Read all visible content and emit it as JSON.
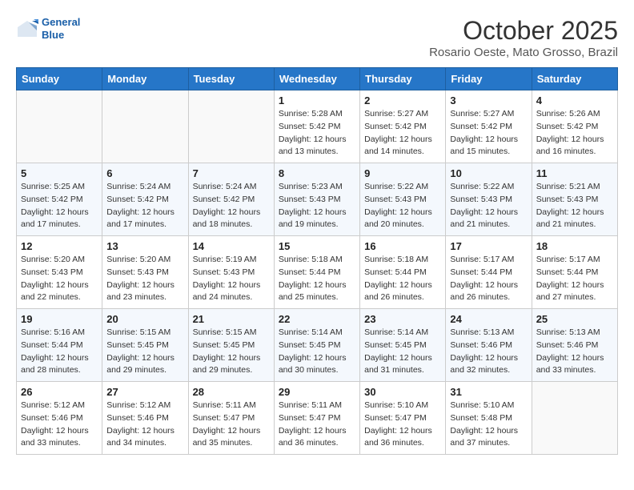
{
  "header": {
    "logo_line1": "General",
    "logo_line2": "Blue",
    "title": "October 2025",
    "subtitle": "Rosario Oeste, Mato Grosso, Brazil"
  },
  "days_of_week": [
    "Sunday",
    "Monday",
    "Tuesday",
    "Wednesday",
    "Thursday",
    "Friday",
    "Saturday"
  ],
  "weeks": [
    [
      {
        "day": "",
        "info": ""
      },
      {
        "day": "",
        "info": ""
      },
      {
        "day": "",
        "info": ""
      },
      {
        "day": "1",
        "info": "Sunrise: 5:28 AM\nSunset: 5:42 PM\nDaylight: 12 hours\nand 13 minutes."
      },
      {
        "day": "2",
        "info": "Sunrise: 5:27 AM\nSunset: 5:42 PM\nDaylight: 12 hours\nand 14 minutes."
      },
      {
        "day": "3",
        "info": "Sunrise: 5:27 AM\nSunset: 5:42 PM\nDaylight: 12 hours\nand 15 minutes."
      },
      {
        "day": "4",
        "info": "Sunrise: 5:26 AM\nSunset: 5:42 PM\nDaylight: 12 hours\nand 16 minutes."
      }
    ],
    [
      {
        "day": "5",
        "info": "Sunrise: 5:25 AM\nSunset: 5:42 PM\nDaylight: 12 hours\nand 17 minutes."
      },
      {
        "day": "6",
        "info": "Sunrise: 5:24 AM\nSunset: 5:42 PM\nDaylight: 12 hours\nand 17 minutes."
      },
      {
        "day": "7",
        "info": "Sunrise: 5:24 AM\nSunset: 5:42 PM\nDaylight: 12 hours\nand 18 minutes."
      },
      {
        "day": "8",
        "info": "Sunrise: 5:23 AM\nSunset: 5:43 PM\nDaylight: 12 hours\nand 19 minutes."
      },
      {
        "day": "9",
        "info": "Sunrise: 5:22 AM\nSunset: 5:43 PM\nDaylight: 12 hours\nand 20 minutes."
      },
      {
        "day": "10",
        "info": "Sunrise: 5:22 AM\nSunset: 5:43 PM\nDaylight: 12 hours\nand 21 minutes."
      },
      {
        "day": "11",
        "info": "Sunrise: 5:21 AM\nSunset: 5:43 PM\nDaylight: 12 hours\nand 21 minutes."
      }
    ],
    [
      {
        "day": "12",
        "info": "Sunrise: 5:20 AM\nSunset: 5:43 PM\nDaylight: 12 hours\nand 22 minutes."
      },
      {
        "day": "13",
        "info": "Sunrise: 5:20 AM\nSunset: 5:43 PM\nDaylight: 12 hours\nand 23 minutes."
      },
      {
        "day": "14",
        "info": "Sunrise: 5:19 AM\nSunset: 5:43 PM\nDaylight: 12 hours\nand 24 minutes."
      },
      {
        "day": "15",
        "info": "Sunrise: 5:18 AM\nSunset: 5:44 PM\nDaylight: 12 hours\nand 25 minutes."
      },
      {
        "day": "16",
        "info": "Sunrise: 5:18 AM\nSunset: 5:44 PM\nDaylight: 12 hours\nand 26 minutes."
      },
      {
        "day": "17",
        "info": "Sunrise: 5:17 AM\nSunset: 5:44 PM\nDaylight: 12 hours\nand 26 minutes."
      },
      {
        "day": "18",
        "info": "Sunrise: 5:17 AM\nSunset: 5:44 PM\nDaylight: 12 hours\nand 27 minutes."
      }
    ],
    [
      {
        "day": "19",
        "info": "Sunrise: 5:16 AM\nSunset: 5:44 PM\nDaylight: 12 hours\nand 28 minutes."
      },
      {
        "day": "20",
        "info": "Sunrise: 5:15 AM\nSunset: 5:45 PM\nDaylight: 12 hours\nand 29 minutes."
      },
      {
        "day": "21",
        "info": "Sunrise: 5:15 AM\nSunset: 5:45 PM\nDaylight: 12 hours\nand 29 minutes."
      },
      {
        "day": "22",
        "info": "Sunrise: 5:14 AM\nSunset: 5:45 PM\nDaylight: 12 hours\nand 30 minutes."
      },
      {
        "day": "23",
        "info": "Sunrise: 5:14 AM\nSunset: 5:45 PM\nDaylight: 12 hours\nand 31 minutes."
      },
      {
        "day": "24",
        "info": "Sunrise: 5:13 AM\nSunset: 5:46 PM\nDaylight: 12 hours\nand 32 minutes."
      },
      {
        "day": "25",
        "info": "Sunrise: 5:13 AM\nSunset: 5:46 PM\nDaylight: 12 hours\nand 33 minutes."
      }
    ],
    [
      {
        "day": "26",
        "info": "Sunrise: 5:12 AM\nSunset: 5:46 PM\nDaylight: 12 hours\nand 33 minutes."
      },
      {
        "day": "27",
        "info": "Sunrise: 5:12 AM\nSunset: 5:46 PM\nDaylight: 12 hours\nand 34 minutes."
      },
      {
        "day": "28",
        "info": "Sunrise: 5:11 AM\nSunset: 5:47 PM\nDaylight: 12 hours\nand 35 minutes."
      },
      {
        "day": "29",
        "info": "Sunrise: 5:11 AM\nSunset: 5:47 PM\nDaylight: 12 hours\nand 36 minutes."
      },
      {
        "day": "30",
        "info": "Sunrise: 5:10 AM\nSunset: 5:47 PM\nDaylight: 12 hours\nand 36 minutes."
      },
      {
        "day": "31",
        "info": "Sunrise: 5:10 AM\nSunset: 5:48 PM\nDaylight: 12 hours\nand 37 minutes."
      },
      {
        "day": "",
        "info": ""
      }
    ]
  ]
}
